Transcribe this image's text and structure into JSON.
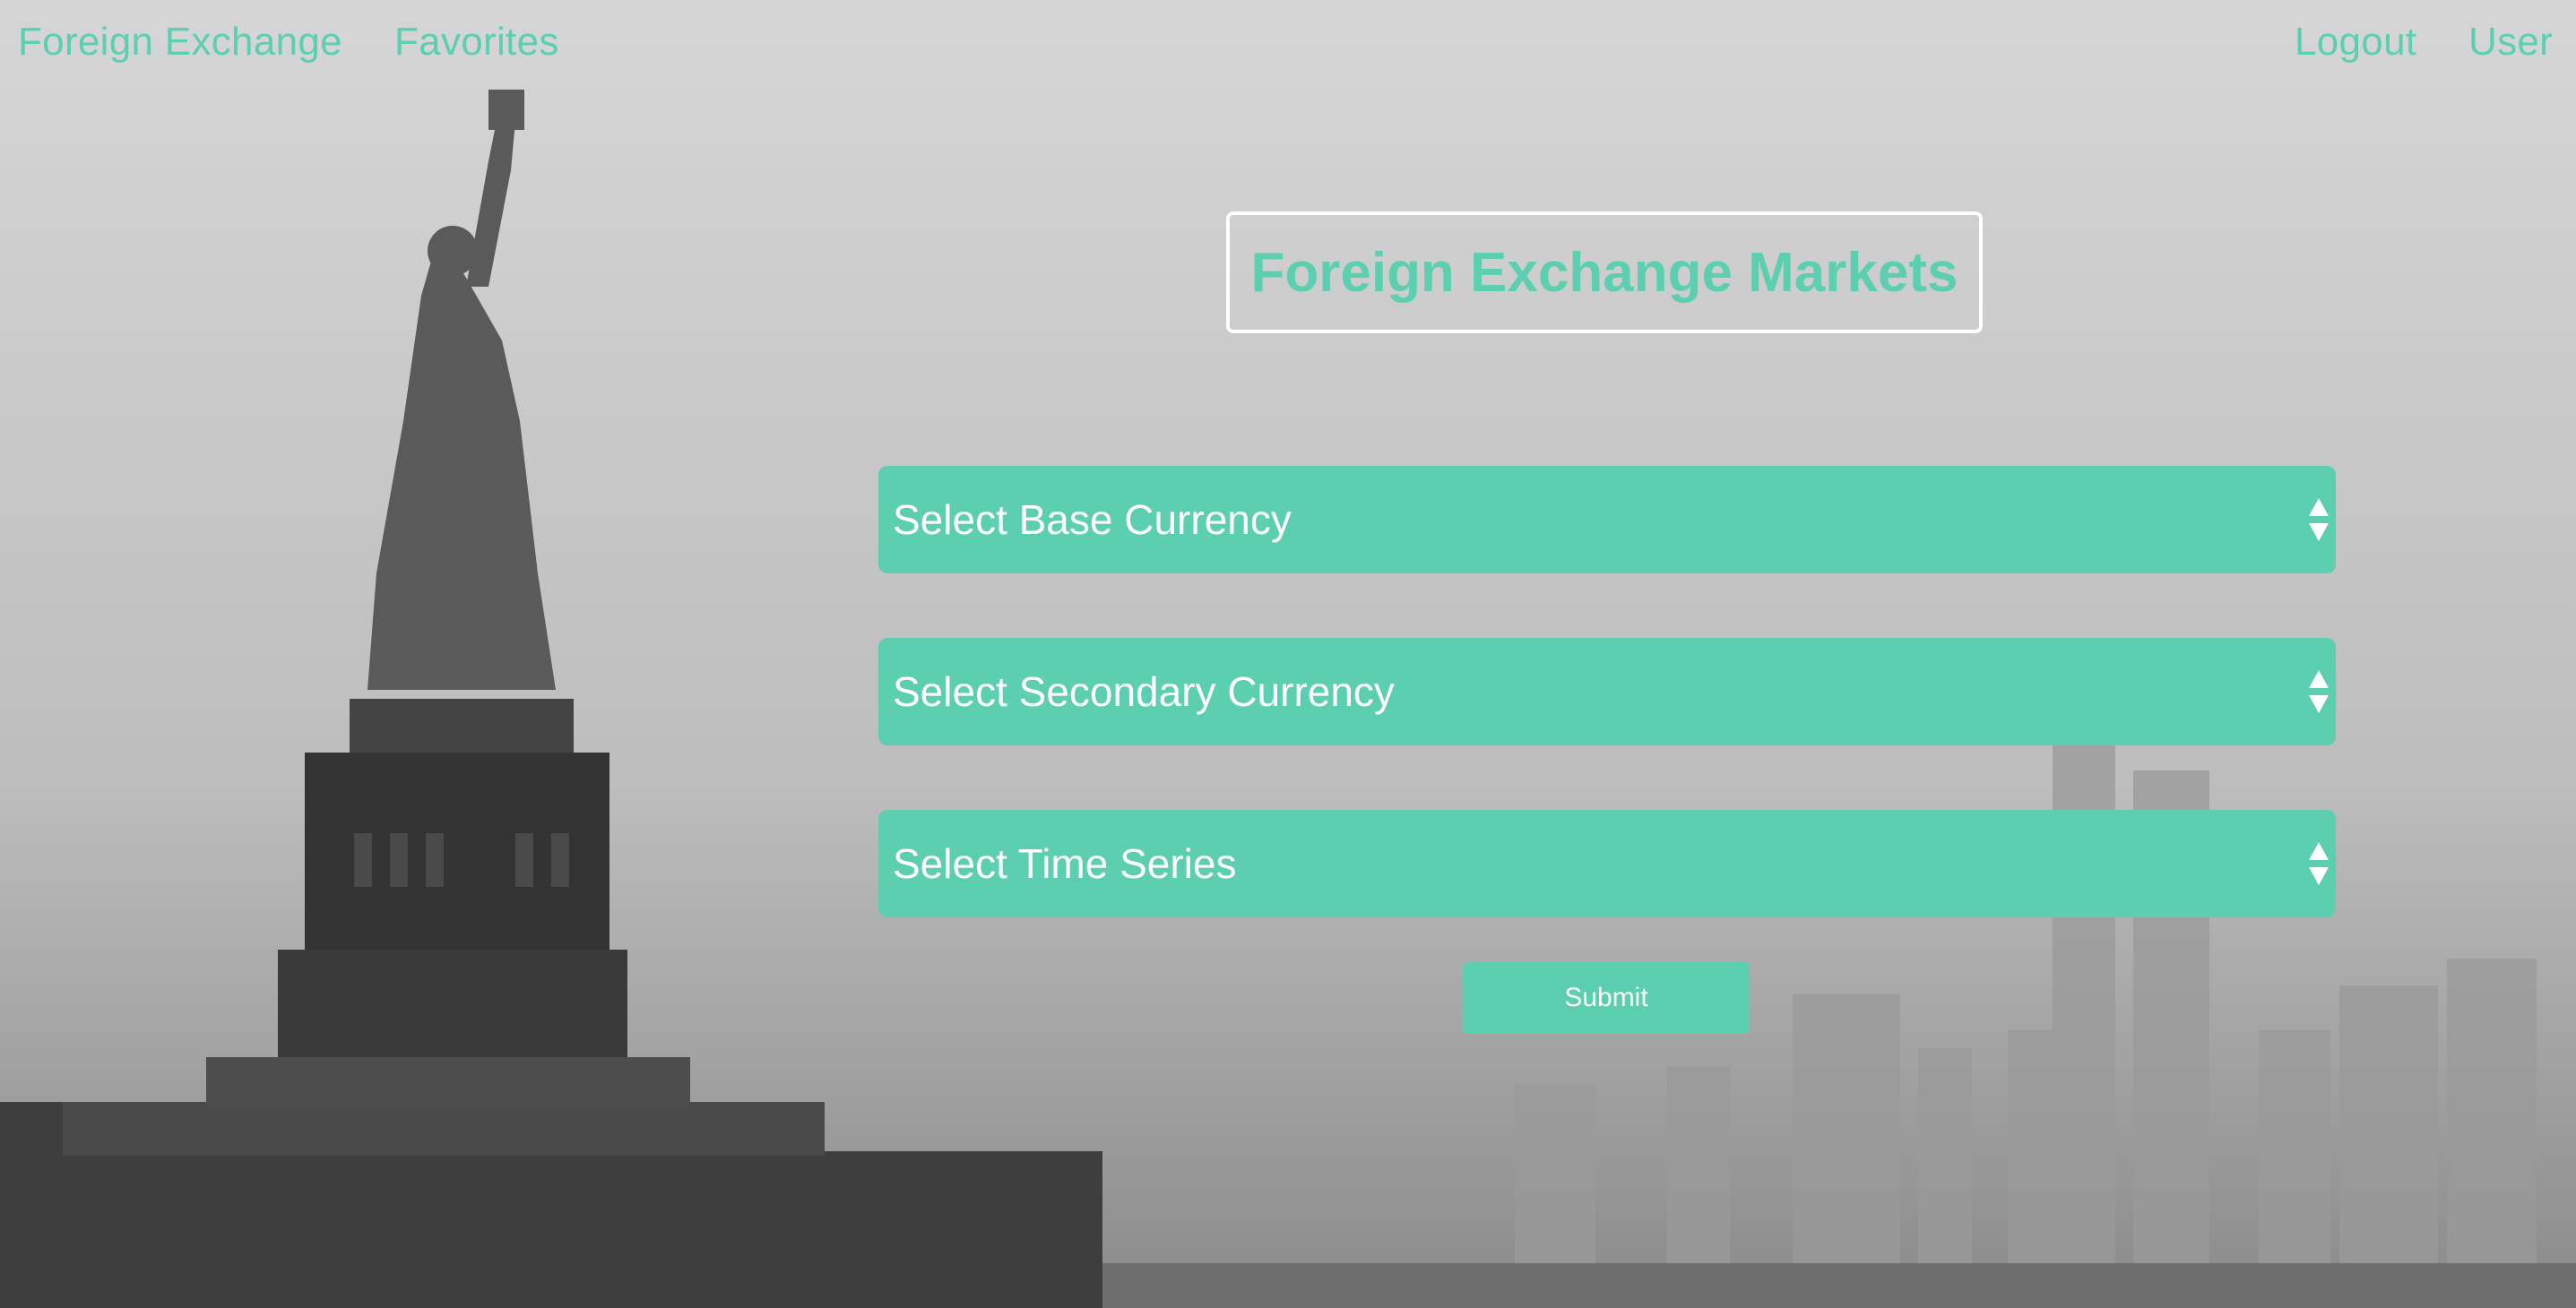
{
  "nav": {
    "brand": "Foreign Exchange",
    "favorites": "Favorites",
    "logout": "Logout",
    "user": "User"
  },
  "main": {
    "title": "Foreign Exchange Markets",
    "selects": [
      {
        "label": "Select Base Currency"
      },
      {
        "label": "Select Secondary Currency"
      },
      {
        "label": "Select Time Series"
      }
    ],
    "submit_label": "Submit"
  },
  "colors": {
    "accent": "#5ccfb0",
    "text_on_accent": "#ffffff"
  },
  "icons": {
    "select_arrow": "up-down-arrows-icon"
  }
}
